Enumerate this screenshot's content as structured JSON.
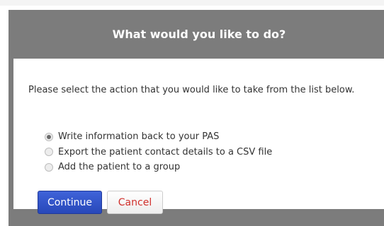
{
  "dialog": {
    "title": "What would you like to do?",
    "prompt": "Please select the action that you would like to take from the list below.",
    "options": [
      {
        "label": "Write information back to your PAS",
        "checked": true
      },
      {
        "label": "Export the patient contact details to a CSV file",
        "checked": false
      },
      {
        "label": "Add the patient to a group",
        "checked": false
      }
    ],
    "buttons": {
      "continue_label": "Continue",
      "cancel_label": "Cancel"
    }
  },
  "colors": {
    "header_bg": "#7c7c7c",
    "primary_button": "#2f52c8",
    "cancel_text": "#d0302c"
  }
}
